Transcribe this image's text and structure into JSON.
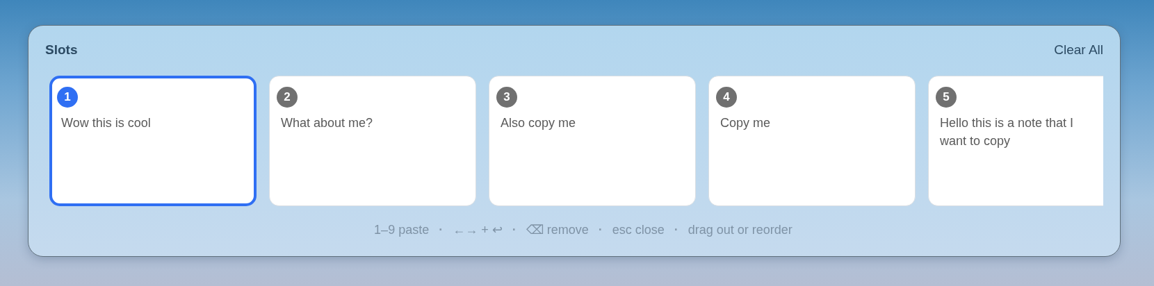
{
  "panel": {
    "title": "Slots",
    "clear_button": "Clear All"
  },
  "slots": [
    {
      "number": "1",
      "text": "Wow this is cool",
      "selected": true
    },
    {
      "number": "2",
      "text": "What about me?",
      "selected": false
    },
    {
      "number": "3",
      "text": "Also copy me",
      "selected": false
    },
    {
      "number": "4",
      "text": "Copy me",
      "selected": false
    },
    {
      "number": "5",
      "text": "Hello this is a note that I want to copy",
      "selected": false
    }
  ],
  "hints": [
    {
      "kind": "hint",
      "text": "1–9 paste"
    },
    {
      "kind": "separator",
      "text": "·"
    },
    {
      "kind": "hint",
      "text": "←→ + ↩"
    },
    {
      "kind": "separator",
      "text": "·"
    },
    {
      "kind": "hint",
      "text": "⌫ remove"
    },
    {
      "kind": "separator",
      "text": "·"
    },
    {
      "kind": "hint",
      "text": "esc close"
    },
    {
      "kind": "separator",
      "text": "·"
    },
    {
      "kind": "hint",
      "text": "drag out or reorder"
    }
  ]
}
